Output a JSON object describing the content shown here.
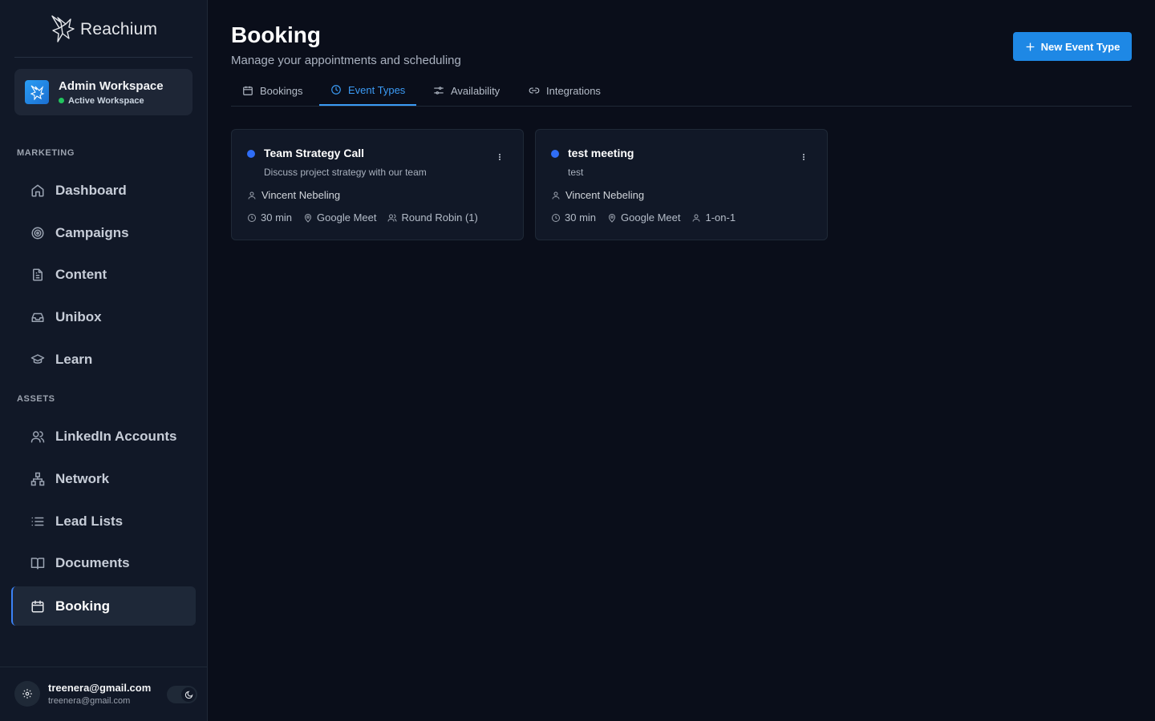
{
  "brand": {
    "name": "Reachium"
  },
  "workspace": {
    "title": "Admin Workspace",
    "status": "Active Workspace"
  },
  "sidebar": {
    "sections": [
      "MARKETING",
      "ASSETS"
    ],
    "items": [
      {
        "label": "Dashboard",
        "icon": "home-icon"
      },
      {
        "label": "Campaigns",
        "icon": "target-icon"
      },
      {
        "label": "Content",
        "icon": "file-text-icon"
      },
      {
        "label": "Unibox",
        "icon": "inbox-icon"
      },
      {
        "label": "Learn",
        "icon": "graduation-cap-icon"
      },
      {
        "label": "LinkedIn Accounts",
        "icon": "users-icon"
      },
      {
        "label": "Network",
        "icon": "network-icon"
      },
      {
        "label": "Lead Lists",
        "icon": "list-icon"
      },
      {
        "label": "Documents",
        "icon": "book-open-icon"
      },
      {
        "label": "Booking",
        "icon": "calendar-icon",
        "active": true
      }
    ]
  },
  "user": {
    "name": "treenera@gmail.com",
    "email": "treenera@gmail.com"
  },
  "header": {
    "title": "Booking",
    "subtitle": "Manage your appointments and scheduling",
    "new_button": "New Event Type"
  },
  "tabs": [
    {
      "label": "Bookings",
      "icon": "calendar-icon"
    },
    {
      "label": "Event Types",
      "icon": "clock-icon",
      "active": true
    },
    {
      "label": "Availability",
      "icon": "sliders-icon"
    },
    {
      "label": "Integrations",
      "icon": "link-icon"
    }
  ],
  "event_types": [
    {
      "title": "Team Strategy Call",
      "description": "Discuss project strategy with our team",
      "host": "Vincent Nebeling",
      "duration": "30 min",
      "location": "Google Meet",
      "type": "Round Robin (1)"
    },
    {
      "title": "test meeting",
      "description": "test",
      "host": "Vincent Nebeling",
      "duration": "30 min",
      "location": "Google Meet",
      "type": "1-on-1"
    }
  ],
  "colors": {
    "accent": "#1e88e5",
    "tab_active": "#3b9bf5",
    "event_dot": "#2f6df6",
    "status_green": "#22c55e"
  }
}
